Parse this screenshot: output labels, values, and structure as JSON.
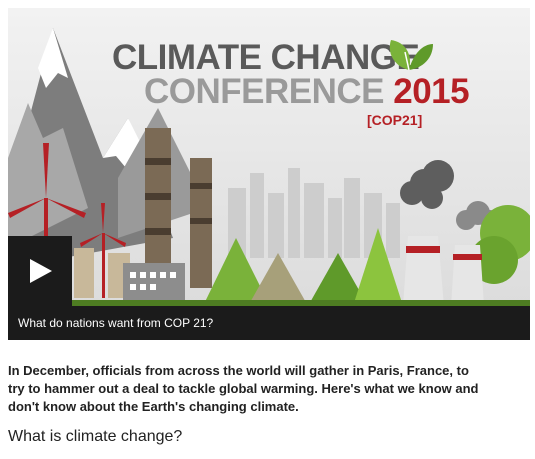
{
  "video": {
    "title_line1": "CLIMATE CHANGE",
    "title_line2_prefix": "CONFERENCE ",
    "title_line2_year": "2015",
    "title_tag": "[COP21]",
    "caption": "What do nations want from COP 21?",
    "play_icon": "play-icon",
    "logo_icon": "leaf-icon"
  },
  "article": {
    "intro": "In December, officials from across the world will gather in Paris, France, to try to hammer out a deal to tackle global warming. Here's what we know and don't know about the Earth's changing climate.",
    "heading": "What is climate change?"
  },
  "colors": {
    "title_dark": "#5a5a5a",
    "title_light": "#9a9a9a",
    "accent_red": "#b52025",
    "leaf_green": "#7ab23a",
    "caption_bg": "#1b1b1b"
  }
}
